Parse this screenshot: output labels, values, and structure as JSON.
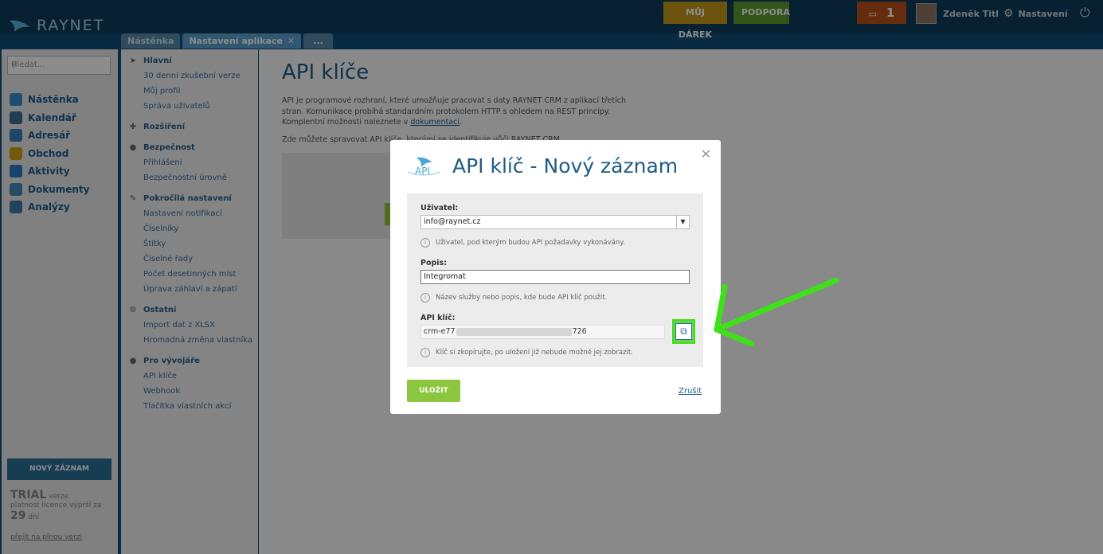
{
  "header": {
    "brand": "RAYNET",
    "gift_label": "MŮJ DÁREK",
    "support_label": "PODPORA",
    "message_count": "1",
    "user_name": "Zdeněk Titl",
    "settings_label": "Nastavení"
  },
  "tabs": [
    {
      "label": "Nástěnka"
    },
    {
      "label": "Nastavení aplikace"
    },
    {
      "label": "..."
    }
  ],
  "sidebar": {
    "search_placeholder": "Hledat...",
    "items": [
      {
        "label": "Nástěnka",
        "icon": "cloud-icon",
        "color": "#3a8fd0"
      },
      {
        "label": "Kalendář",
        "icon": "calendar-icon",
        "color": "#3b6f9a"
      },
      {
        "label": "Adresář",
        "icon": "contacts-icon",
        "color": "#3b7fbd"
      },
      {
        "label": "Obchod",
        "icon": "dollar-icon",
        "color": "#d4a017"
      },
      {
        "label": "Aktivity",
        "icon": "activity-icon",
        "color": "#2e7bc4"
      },
      {
        "label": "Dokumenty",
        "icon": "documents-icon",
        "color": "#4a89b8"
      },
      {
        "label": "Analýzy",
        "icon": "chart-icon",
        "color": "#3d7ab0"
      }
    ],
    "new_record_label": "NOVÝ ZÁZNAM",
    "trial_word": "TRIAL",
    "trial_suffix": "verze",
    "trial_line": "platnost licence vyprší za",
    "trial_days": "29",
    "trial_days_word": "dní",
    "trial_link": "přejít na plnou verzi"
  },
  "menu": {
    "sections": [
      {
        "title": "Hlavní",
        "icon": "bird-icon",
        "items": [
          "30 denní zkušební verze",
          "Můj profil",
          "Správa uživatelů"
        ]
      },
      {
        "title": "Rozšíření",
        "icon": "plus-icon",
        "items": []
      },
      {
        "title": "Bezpečnost",
        "icon": "lock-icon",
        "items": [
          "Přihlášení",
          "Bezpečnostní úrovně"
        ]
      },
      {
        "title": "Pokročilá nastavení",
        "icon": "wrench-icon",
        "items": [
          "Nastavení notifikací",
          "Číselníky",
          "Štítky",
          "Číselné řady",
          "Počet desetinných míst",
          "Úprava záhlaví a zápatí"
        ]
      },
      {
        "title": "Ostatní",
        "icon": "gear-icon",
        "items": [
          "Import dat z XLSX",
          "Hromadná změna vlastníka"
        ]
      },
      {
        "title": "Pro vývojáře",
        "icon": "people-icon",
        "items": [
          "API klíče",
          "Webhook",
          "Tlačítka vlastních akcí"
        ]
      }
    ]
  },
  "main": {
    "title": "API klíče",
    "desc_part1": "API je programové rozhraní, které umožňuje pracovat s daty RAYNET CRM z aplikací třetích stran. Komunikace probíhá standardním protokolem HTTP s ohledem na REST principy. Komplentní možnosti naleznete v ",
    "desc_link": "dokumentaci",
    "desc_end": ".",
    "desc2": "Zde můžete spravovat API klíče, kterými se identifikuje vůči RAYNET CRM."
  },
  "modal": {
    "logo_text": "API",
    "title": "API klíč - Nový záznam",
    "user_label": "Uživatel:",
    "user_value": "info@raynet.cz",
    "user_hint": "Uživatel, pod kterým budou API požadavky vykonávány.",
    "desc_label": "Popis:",
    "desc_value": "Integromat",
    "desc_hint": "Název služby nebo popis, kde bude API klíč použit.",
    "key_label": "API klíč:",
    "key_prefix": "crm-e77",
    "key_suffix": "726",
    "key_hint": "Klíč si zkopírujte, po uložení již nebude možné jej zobrazit.",
    "save_label": "ULOŽIT",
    "cancel_label": "Zrušit"
  },
  "colors": {
    "topbar": "#0d3d5c",
    "brand_blue": "#1e5b87",
    "save_green": "#8cc63f",
    "annotation_green": "#3ee01a"
  }
}
